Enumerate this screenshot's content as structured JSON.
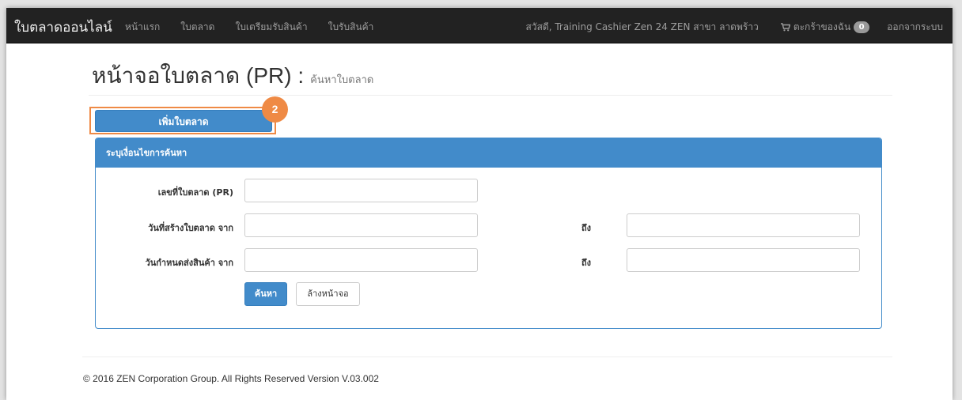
{
  "navbar": {
    "brand": "ใบตลาดออนไลน์",
    "links": [
      "หน้าแรก",
      "ใบตลาด",
      "ใบเตรียมรับสินค้า",
      "ใบรับสินค้า"
    ],
    "greeting": "สวัสดี, Training Cashier Zen 24 ZEN สาขา ลาดพร้าว",
    "cart_label": "ตะกร้าของฉัน",
    "cart_count": "0",
    "logout": "ออกจากระบบ"
  },
  "page": {
    "title": "หน้าจอใบตลาด (PR) :",
    "subtitle": "ค้นหาใบตลาด"
  },
  "add_button": "เพิ่มใบตลาด",
  "step_badge": "2",
  "search_panel": {
    "title": "ระบุเงื่อนไขการค้นหา",
    "pr_number_label": "เลขที่ใบตลาด (PR)",
    "created_from_label": "วันที่สร้างใบตลาด จาก",
    "created_to_label": "ถึง",
    "delivery_from_label": "วันกำหนดส่งสินค้า จาก",
    "delivery_to_label": "ถึง",
    "pr_number_value": "",
    "created_from_value": "",
    "created_to_value": "",
    "delivery_from_value": "",
    "delivery_to_value": "",
    "search_button": "ค้นหา",
    "clear_button": "ล้างหน้าจอ"
  },
  "footer": "© 2016 ZEN Corporation Group. All Rights Reserved Version V.03.002",
  "colors": {
    "navbar_bg": "#222222",
    "primary": "#428bca",
    "highlight": "#ef8a45"
  },
  "icons": {
    "cart": "shopping-cart-icon"
  }
}
